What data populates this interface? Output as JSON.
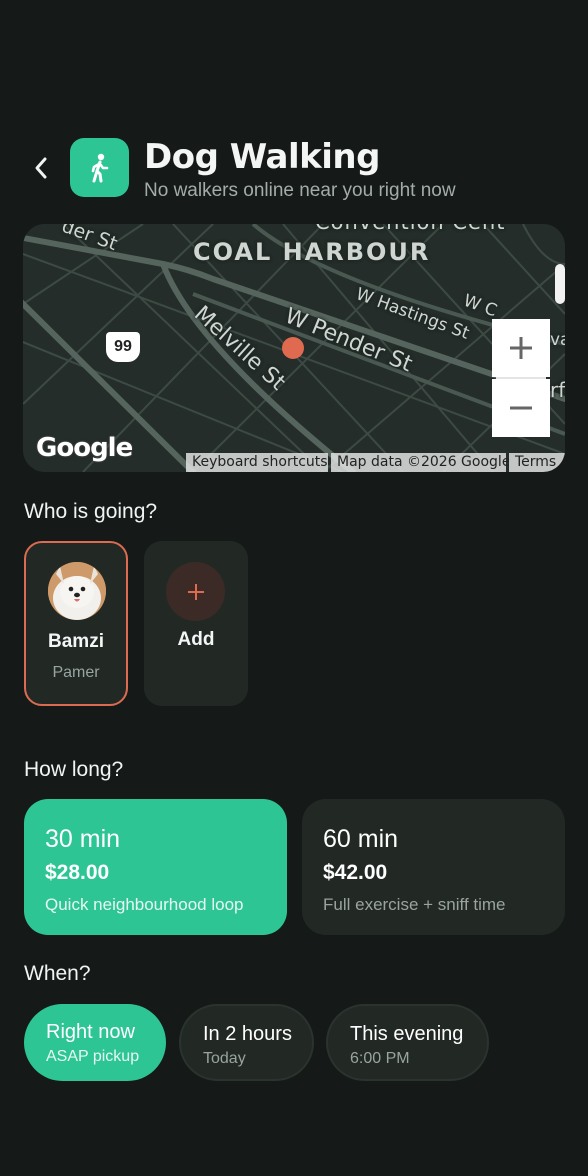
{
  "header": {
    "title": "Dog Walking",
    "subtitle": "No walkers online near you right now"
  },
  "map": {
    "labels": {
      "top_street": "der St",
      "top_right": "Convention Cent",
      "area": "COAL HARBOUR",
      "hastings": "W Hastings St",
      "corner": "W C",
      "corner2": "va",
      "melville": "Melville St",
      "pender": "W Pender St",
      "waterfront": "W",
      "waterfront2": "rf",
      "route_shield": "99"
    },
    "google_logo": "Google",
    "attribution": {
      "shortcuts": "Keyboard shortcuts",
      "data": "Map data ©2026 Google",
      "terms": "Terms"
    },
    "marker_color": "#e06a4f"
  },
  "who": {
    "title": "Who is going?",
    "pet": {
      "name": "Bamzi",
      "breed": "Pamer"
    },
    "add_label": "Add"
  },
  "duration": {
    "title": "How long?",
    "options": [
      {
        "name": "30 min",
        "price": "$28.00",
        "desc": "Quick neighbourhood loop",
        "selected": true
      },
      {
        "name": "60 min",
        "price": "$42.00",
        "desc": "Full exercise + sniff time",
        "selected": false
      }
    ]
  },
  "when": {
    "title": "When?",
    "options": [
      {
        "main": "Right now",
        "sub": "ASAP pickup",
        "selected": true
      },
      {
        "main": "In 2 hours",
        "sub": "Today",
        "selected": false
      },
      {
        "main": "This evening",
        "sub": "6:00 PM",
        "selected": false
      }
    ]
  },
  "colors": {
    "background": "#151a18",
    "accent": "#2ec594",
    "card": "#222925",
    "highlight_border": "#dc6b51"
  }
}
